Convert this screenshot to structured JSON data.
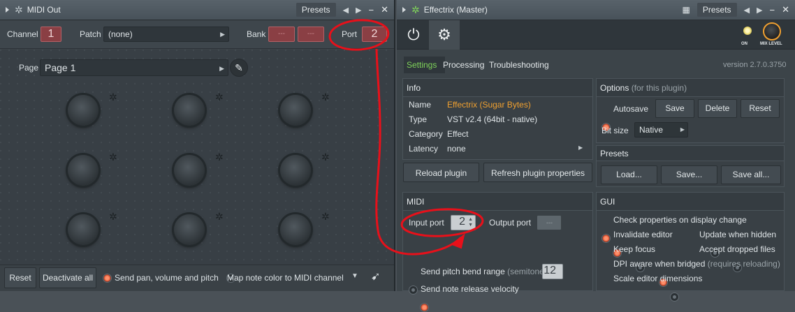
{
  "midi_out": {
    "title": "MIDI Out",
    "presets_label": "Presets",
    "min_glyph": "−",
    "close_glyph": "✕",
    "channel_label": "Channel",
    "channel_value": "1",
    "patch_label": "Patch",
    "patch_value": "(none)",
    "bank_label": "Bank",
    "bank_value_1": "---",
    "bank_value_2": "---",
    "port_label": "Port",
    "port_value": "2",
    "page_label": "Page",
    "page_value": "Page 1",
    "reset_label": "Reset",
    "deactivate_label": "Deactivate all",
    "send_pan_label": "Send pan, volume and pitch",
    "send_pan_checked": true,
    "map_color_label": "Map note color to MIDI channel",
    "map_color_checked": false
  },
  "effectrix": {
    "title": "Effectrix (Master)",
    "presets_label": "Presets",
    "min_glyph": "−",
    "close_glyph": "✕",
    "on_label": "ON",
    "mix_level_label": "MIX LEVEL",
    "tabs": [
      "Settings",
      "Processing",
      "Troubleshooting"
    ],
    "active_tab": "Settings",
    "version": "version 2.7.0.3750",
    "info": {
      "header": "Info",
      "rows": [
        {
          "key": "Name",
          "value": "Effectrix (Sugar Bytes)"
        },
        {
          "key": "Type",
          "value": "VST v2.4 (64bit - native)"
        },
        {
          "key": "Category",
          "value": "Effect"
        },
        {
          "key": "Latency",
          "value": "none"
        }
      ]
    },
    "reload_label": "Reload plugin",
    "refresh_label": "Refresh plugin properties",
    "options": {
      "header": "Options",
      "header_note": "(for this plugin)",
      "autosave_label": "Autosave",
      "autosave_checked": true,
      "save_label": "Save",
      "delete_label": "Delete",
      "reset_label": "Reset",
      "bitsize_label": "Bit size",
      "bitsize_value": "Native"
    },
    "presets": {
      "header": "Presets",
      "load_label": "Load...",
      "save_label": "Save...",
      "saveall_label": "Save all..."
    },
    "midi": {
      "header": "MIDI",
      "input_port_label": "Input port",
      "input_port_value": "2",
      "output_port_label": "Output port",
      "output_port_value": "---",
      "pitch_bend_label": "Send pitch bend range",
      "pitch_bend_note": "(semitones)",
      "pitch_bend_value": "12",
      "note_release_label": "Send note release velocity"
    },
    "gui": {
      "header": "GUI",
      "check_props": "Check properties on display change",
      "invalidate": "Invalidate editor",
      "update_hidden": "Update when hidden",
      "keep_focus": "Keep focus",
      "accept_dropped": "Accept dropped files",
      "dpi_aware": "DPI aware when bridged",
      "dpi_note": "(requires reloading)",
      "scale_dims": "Scale editor dimensions"
    }
  },
  "colors": {
    "annotation_red": "#e8101a",
    "accent_orange": "#f0a030",
    "tab_green": "#7fd35a"
  }
}
